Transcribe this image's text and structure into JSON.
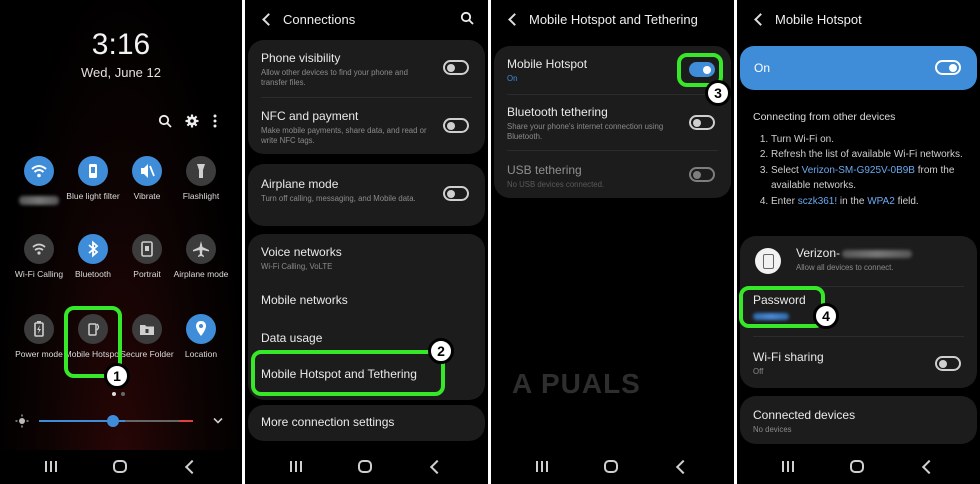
{
  "colors": {
    "accent": "#3f8cd8",
    "highlight": "#37e829",
    "card": "#1c1c1c",
    "background": "#000000"
  },
  "lockscreen": {
    "time": "3:16",
    "date": "Wed, June 12",
    "tiles": [
      {
        "label": "",
        "icon": "wifi-icon",
        "on": true,
        "blurred": true
      },
      {
        "label": "Blue light filter",
        "icon": "blue-light-icon",
        "on": true
      },
      {
        "label": "Vibrate",
        "icon": "vibrate-icon",
        "on": true
      },
      {
        "label": "Flashlight",
        "icon": "flashlight-icon",
        "on": false
      },
      {
        "label": "Wi-Fi Calling",
        "icon": "wifi-calling-icon",
        "on": false
      },
      {
        "label": "Bluetooth",
        "icon": "bluetooth-icon",
        "on": true
      },
      {
        "label": "Portrait",
        "icon": "portrait-icon",
        "on": false
      },
      {
        "label": "Airplane mode",
        "icon": "airplane-icon",
        "on": false
      },
      {
        "label": "Power mode",
        "icon": "power-mode-icon",
        "on": false
      },
      {
        "label": "Mobile Hotspot",
        "icon": "hotspot-icon",
        "on": false
      },
      {
        "label": "Secure Folder",
        "icon": "secure-folder-icon",
        "on": false
      },
      {
        "label": "Location",
        "icon": "location-icon",
        "on": true
      }
    ],
    "brightness_level": 0.49,
    "badge": "1"
  },
  "connections": {
    "title": "Connections",
    "items": [
      {
        "title": "Phone visibility",
        "subtitle": "Allow other devices to find your phone and transfer files."
      },
      {
        "title": "NFC and payment",
        "subtitle": "Make mobile payments, share data, and read or write NFC tags."
      },
      {
        "title": "Airplane mode",
        "subtitle": "Turn off calling, messaging, and Mobile data."
      },
      {
        "title": "Voice networks",
        "subtitle": "Wi-Fi Calling, VoLTE"
      },
      {
        "title": "Mobile networks",
        "subtitle": ""
      },
      {
        "title": "Data usage",
        "subtitle": ""
      },
      {
        "title": "Mobile Hotspot and Tethering",
        "subtitle": ""
      },
      {
        "title": "More connection settings",
        "subtitle": ""
      }
    ],
    "badge": "2"
  },
  "tethering": {
    "title": "Mobile Hotspot and Tethering",
    "items": [
      {
        "title": "Mobile Hotspot",
        "subtitle": "On"
      },
      {
        "title": "Bluetooth tethering",
        "subtitle": "Share your phone's internet connection using Bluetooth."
      },
      {
        "title": "USB tethering",
        "subtitle": "No USB devices connected."
      }
    ],
    "badge": "3",
    "watermark": "A PUALS"
  },
  "hotspot": {
    "title": "Mobile Hotspot",
    "state_label": "On",
    "instructions_heading": "Connecting from other devices",
    "step1": "Turn Wi-Fi on.",
    "step2": "Refresh the list of available Wi-Fi networks.",
    "step3_pre": "Select ",
    "step3_link": "Verizon-SM-G925V-0B9B",
    "step3_post": " from the available networks.",
    "step4_pre": "Enter ",
    "step4_pass": "sczk361!",
    "step4_mid": " in the ",
    "step4_link": "WPA2",
    "step4_post": " field.",
    "network_name": "Verizon-",
    "network_sub": "Allow all devices to connect.",
    "password_label": "Password",
    "wifi_sharing": "Wi-Fi sharing",
    "wifi_sharing_state": "Off",
    "connected_devices": "Connected devices",
    "connected_devices_state": "No devices",
    "badge": "4"
  }
}
